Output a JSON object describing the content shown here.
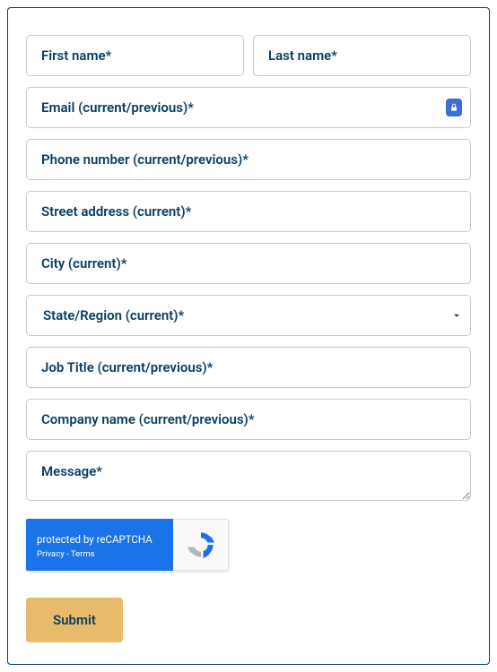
{
  "fields": {
    "first_name": {
      "placeholder": "First name*"
    },
    "last_name": {
      "placeholder": "Last name*"
    },
    "email": {
      "placeholder": "Email (current/previous)*"
    },
    "phone": {
      "placeholder": "Phone number (current/previous)*"
    },
    "street": {
      "placeholder": "Street address (current)*"
    },
    "city": {
      "placeholder": "City (current)*"
    },
    "state": {
      "placeholder": "State/Region (current)*"
    },
    "job_title": {
      "placeholder": "Job Title (current/previous)*"
    },
    "company": {
      "placeholder": "Company name (current/previous)*"
    },
    "message": {
      "placeholder": "Message*"
    }
  },
  "recaptcha": {
    "title": "protected by reCAPTCHA",
    "privacy": "Privacy",
    "sep": " - ",
    "terms": "Terms"
  },
  "submit": {
    "label": "Submit"
  }
}
